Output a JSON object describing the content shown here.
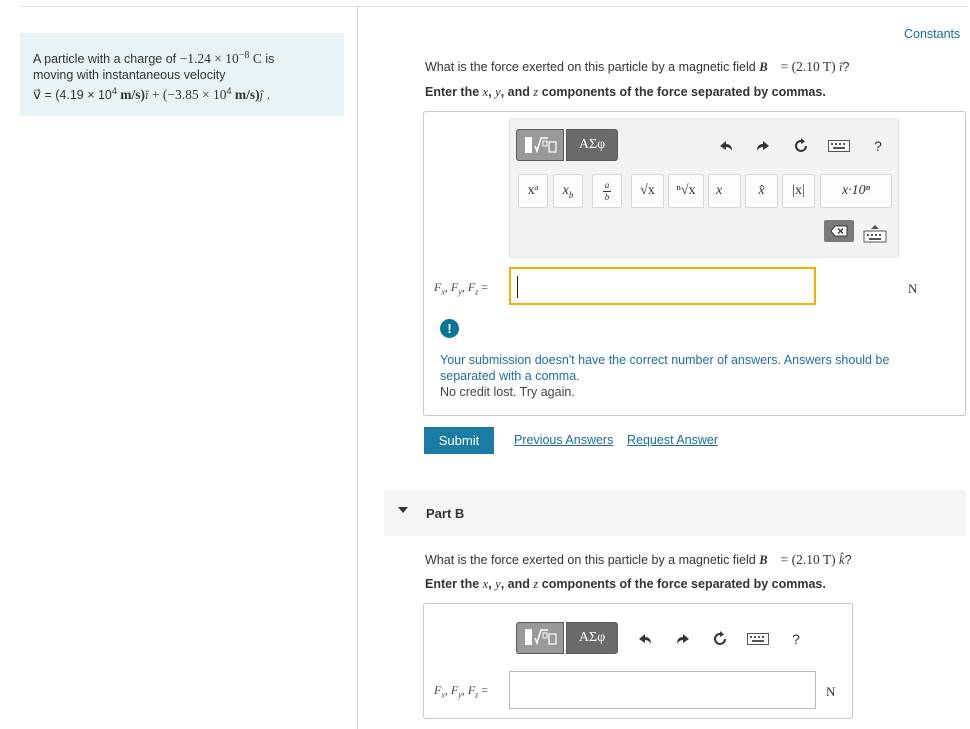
{
  "problem": {
    "line1_prefix": "A particle with a charge of ",
    "charge_mant": "−1.24 × 10",
    "charge_exp": "−8",
    "charge_unit": "C",
    "line1_suffix": " is",
    "line2": "moving with instantaneous velocity",
    "vel_sym": "v⃗",
    "vel_eq": " = (4.19 × 10",
    "vel_exp1": "4",
    "vel_unit1": " m/s)",
    "vel_i": "î",
    "vel_mid": " + (−3.85 × 10",
    "vel_exp2": "4",
    "vel_unit2": " m/s)",
    "vel_j": "ĵ",
    "vel_end": " ."
  },
  "header": {
    "constants_link": "Constants"
  },
  "part_a": {
    "question_prefix": "What is the force exerted on this particle by a magnetic field ",
    "field_sym": "B⃗",
    "field_value": " = (2.10  T) ",
    "field_dir": "î",
    "question_end": "?",
    "instruct_prefix": "Enter the ",
    "instruct_x": "x",
    "instruct_y": "y",
    "instruct_and": ", and ",
    "instruct_z": "z",
    "instruct_suffix": " components of the force separated by commas.",
    "comma": ", ",
    "input_label": "Fx, Fy, Fz =",
    "input_value": "",
    "unit": "N",
    "feedback_line1": "Your submission doesn't have the correct number of answers. Answers should be",
    "feedback_line2": "separated with a comma.",
    "feedback_line3": "No credit lost. Try again.",
    "submit_label": "Submit",
    "previous_answers": "Previous Answers",
    "request_answer": "Request Answer"
  },
  "part_b": {
    "title": "Part B",
    "question_prefix": "What is the force exerted on this particle by a magnetic field ",
    "field_sym": "B⃗",
    "field_value": " = (2.10  T) ",
    "field_dir": "k̂",
    "question_end": "?",
    "instruct_prefix": "Enter the ",
    "instruct_x": "x",
    "instruct_y": "y",
    "instruct_and": ", and ",
    "instruct_z": "z",
    "instruct_suffix": " components of the force separated by commas.",
    "comma": ", ",
    "input_label": "Fx, Fy, Fz =",
    "input_value": "",
    "unit": "N"
  },
  "toolbar": {
    "greek_label": "ΑΣφ",
    "help_label": "?",
    "templates": [
      "xᵃ",
      "x_b",
      "a/b",
      "√x",
      "ⁿ√x",
      "x⃗",
      "x̂",
      "|x|",
      "x·10ⁿ"
    ],
    "icons": [
      "matrix-icon",
      "undo-icon",
      "redo-icon",
      "reset-icon",
      "keyboard-icon",
      "help-icon",
      "backspace-icon",
      "keyboard-toggle-icon"
    ]
  }
}
